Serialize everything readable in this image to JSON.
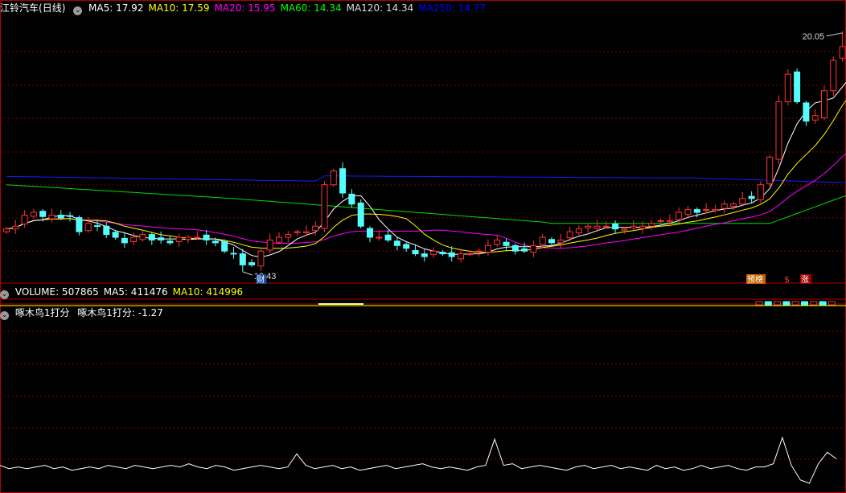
{
  "stock": {
    "name": "江铃汽车",
    "period": "(日线)"
  },
  "ma_legend": [
    {
      "label": "MA5: 17.92",
      "color": "#ffffff"
    },
    {
      "label": "MA10: 17.59",
      "color": "#ffff00"
    },
    {
      "label": "MA20: 15.95",
      "color": "#ff00ff"
    },
    {
      "label": "MA60: 14.34",
      "color": "#00ff00"
    },
    {
      "label": "MA120: 14.34",
      "color": "#dddddd"
    },
    {
      "label": "MA250: 14.77",
      "color": "#0000ff"
    }
  ],
  "volume_legend": [
    {
      "label": "VOLUME: 507865",
      "color": "#ffffff"
    },
    {
      "label": "MA5: 411476",
      "color": "#ffffff"
    },
    {
      "label": "MA10: 414996",
      "color": "#ffff00"
    }
  ],
  "indicator_legend": {
    "name": "啄木鸟1打分",
    "value": "啄木鸟1打分: -1.27"
  },
  "annotations": {
    "high": "20.05",
    "low": "12.43",
    "cai": "财",
    "yu": "预榜",
    "s": "$",
    "zhang": "涨"
  },
  "colors": {
    "up": "#ff3232",
    "down": "#54fcfc",
    "grid": "#800000",
    "border": "#b00000"
  },
  "chart_data": {
    "type": "candlestick",
    "close": [
      12.9,
      13.0,
      13.4,
      13.5,
      13.35,
      13.4,
      13.3,
      13.35,
      12.8,
      13.1,
      13.0,
      12.7,
      12.6,
      12.4,
      12.6,
      12.7,
      12.5,
      12.5,
      12.4,
      12.6,
      12.6,
      12.6,
      12.5,
      12.4,
      12.1,
      12.0,
      11.6,
      11.6,
      12.1,
      12.5,
      12.6,
      12.7,
      12.8,
      12.8,
      13.0,
      14.5,
      15.0,
      14.2,
      13.8,
      13.0,
      12.6,
      12.6,
      12.5,
      12.3,
      12.2,
      12.0,
      11.9,
      12.1,
      12.0,
      11.9,
      12.0,
      12.0,
      12.1,
      12.3,
      12.5,
      12.3,
      12.1,
      12.1,
      12.3,
      12.6,
      12.4,
      12.5,
      12.8,
      12.9,
      13.0,
      13.0,
      13.0,
      12.9,
      12.9,
      13.0,
      13.0,
      13.1,
      13.2,
      13.2,
      13.5,
      13.6,
      13.5,
      13.6,
      13.6,
      13.8,
      13.8,
      14.0,
      14.0,
      14.5,
      15.5,
      17.5,
      18.5,
      17.5,
      16.8,
      17.0,
      17.9,
      19.0,
      19.5,
      18.8
    ],
    "ylim": [
      11.0,
      20.6
    ],
    "ma_periods": [
      5,
      10,
      20,
      60,
      250
    ],
    "volume": {
      "ma5": 411476,
      "ma10": 414996,
      "last": 507865
    },
    "score": [
      -1.3,
      -1.5,
      -1.4,
      -1.5,
      -1.4,
      -1.3,
      -1.5,
      -1.4,
      -1.6,
      -1.5,
      -1.4,
      -1.5,
      -1.3,
      -1.4,
      -1.5,
      -1.3,
      -1.4,
      -1.5,
      -1.4,
      -1.3,
      -1.4,
      -1.2,
      -1.4,
      -1.5,
      -1.3,
      -1.4,
      -1.6,
      -1.5,
      -1.4,
      -1.3,
      -1.4,
      -1.5,
      -1.4,
      -0.6,
      -1.3,
      -1.5,
      -1.4,
      -1.3,
      -1.5,
      -1.4,
      -1.6,
      -1.5,
      -1.4,
      -1.3,
      -1.5,
      -1.4,
      -1.3,
      -1.2,
      -1.4,
      -1.5,
      -1.4,
      -1.5,
      -1.6,
      -1.4,
      -1.3,
      0.3,
      -1.3,
      -1.2,
      -1.5,
      -1.4,
      -1.3,
      -1.4,
      -1.5,
      -1.6,
      -1.4,
      -1.3,
      -1.5,
      -1.4,
      -1.3,
      -1.5,
      -1.4,
      -1.5,
      -1.6,
      -1.3,
      -1.5,
      -1.4,
      -1.6,
      -1.5,
      -1.3,
      -1.5,
      -1.4,
      -1.3,
      -1.5,
      -1.6,
      -1.4,
      -1.4,
      -1.2,
      0.4,
      -1.3,
      -2.2,
      -2.4,
      -1.2,
      -0.5,
      -0.9
    ]
  }
}
